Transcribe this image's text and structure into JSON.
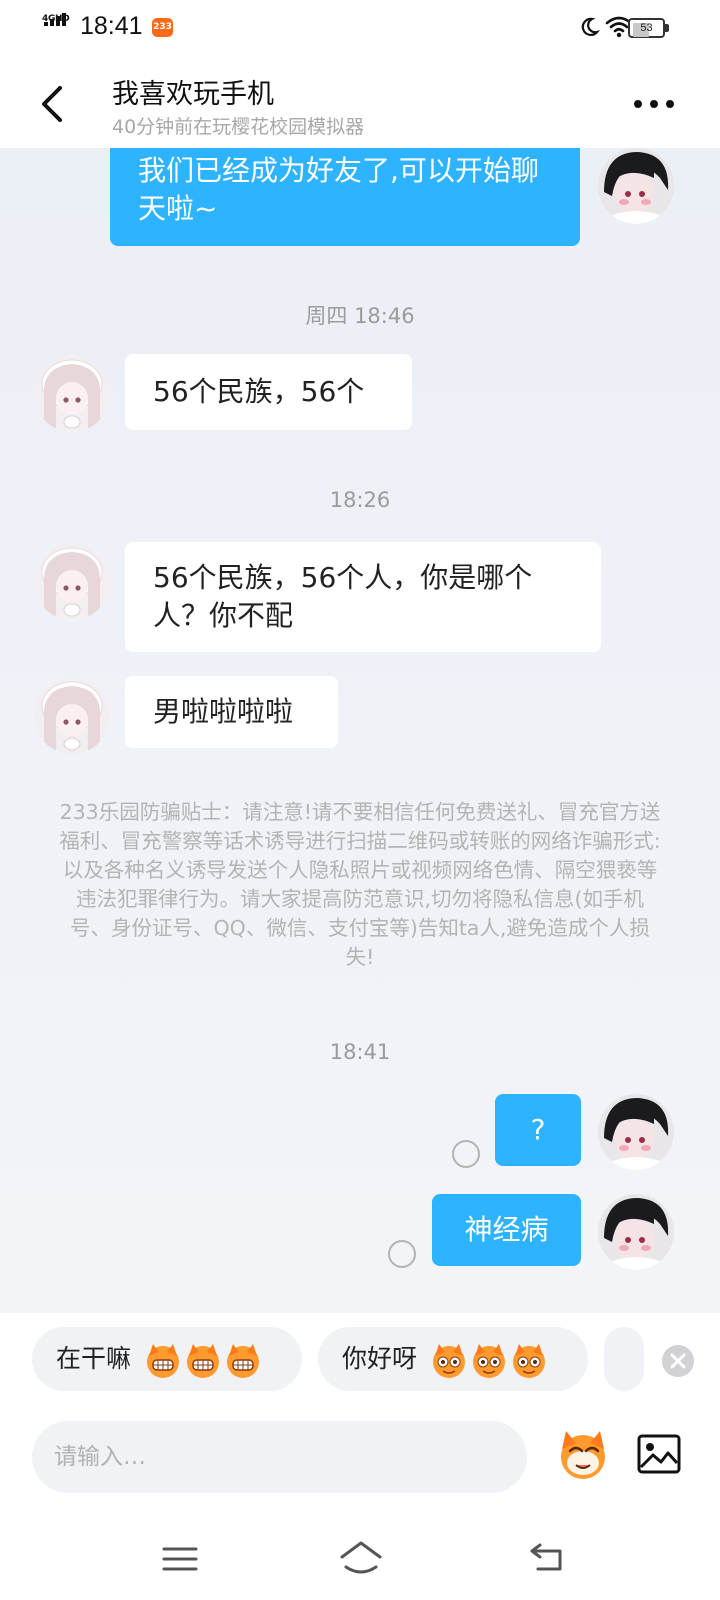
{
  "status_bar": {
    "network": "4GHD",
    "time": "18:41",
    "app_badge": "233",
    "battery": "53"
  },
  "header": {
    "title": "我喜欢玩手机",
    "subtitle": "40分钟前在玩樱花校园模拟器"
  },
  "messages": {
    "m1": "我们已经成为好友了,可以开始聊天啦~",
    "t1": "周四 18:46",
    "m2": "56个民族，56个",
    "t2": "18:26",
    "m3": "56个民族，56个人，你是哪个人？你不配",
    "m4": "男啦啦啦啦",
    "tips": "233乐园防骗贴士：请注意!请不要相信任何免费送礼、冒充官方送福利、冒充警察等话术诱导进行扫描二维码或转账的网络诈骗形式:以及各种名义诱导发送个人隐私照片或视频网络色情、隔空猥亵等违法犯罪律行为。请大家提高防范意识,切勿将隐私信息(如手机号、身份证号、QQ、微信、支付宝等)告知ta人,避免造成个人损失!",
    "t3": "18:41",
    "m5": "?",
    "m6": "神经病"
  },
  "quick_replies": [
    "在干嘛",
    "你好呀"
  ],
  "input": {
    "placeholder": "请输入…"
  },
  "colors": {
    "outgoing_bubble": "#2db3ff",
    "chat_bg": "#ebeff6",
    "accent_orange": "#ff7a1a"
  }
}
